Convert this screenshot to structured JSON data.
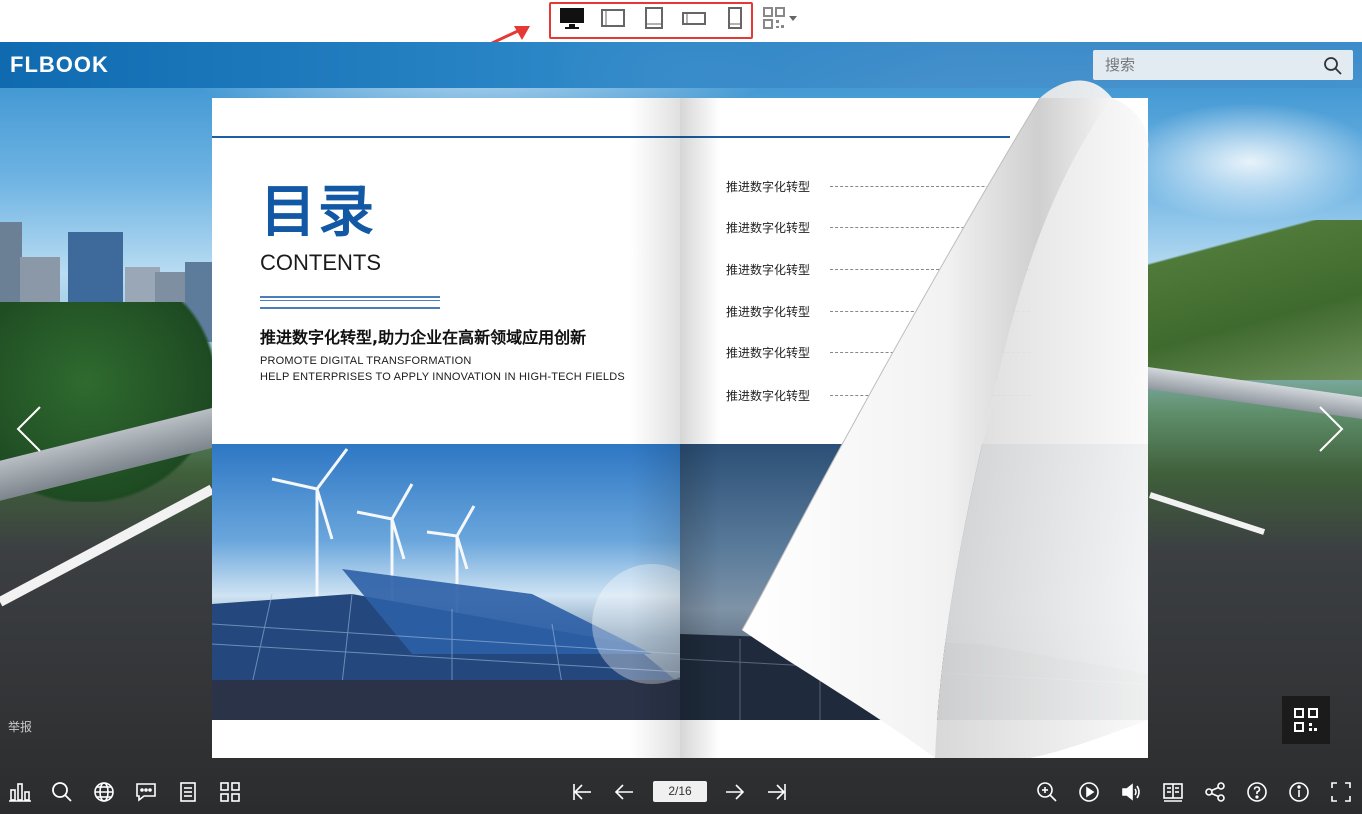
{
  "device_bar": {
    "options": [
      {
        "icon": "desktop-icon"
      },
      {
        "icon": "tablet-landscape-icon"
      },
      {
        "icon": "tablet-portrait-icon"
      },
      {
        "icon": "phone-landscape-icon"
      },
      {
        "icon": "phone-portrait-icon"
      }
    ],
    "qr_menu_icon": "qr-code-icon",
    "highlight_color": "#e53935"
  },
  "header": {
    "logo": "FLBOOK",
    "search": {
      "placeholder": "搜索",
      "value": ""
    }
  },
  "book": {
    "left_page": {
      "title": "目录",
      "subtitle": "CONTENTS",
      "headline": "推进数字化转型,助力企业在高新领域应用创新",
      "english_line1": "PROMOTE DIGITAL TRANSFORMATION",
      "english_line2": "HELP ENTERPRISES TO APPLY INNOVATION IN HIGH-TECH FIELDS"
    },
    "right_page": {
      "toc_items": [
        "推进数字化转型",
        "推进数字化转型",
        "推进数字化转型",
        "推进数字化转型",
        "推进数字化转型",
        "推进数字化转型"
      ]
    },
    "accent_color": "#1258a4"
  },
  "footer": {
    "report_link": "举报",
    "page_indicator": "2/16",
    "left_tools": [
      "stats-icon",
      "search-icon",
      "globe-icon",
      "comment-icon",
      "text-icon",
      "thumbnails-icon"
    ],
    "nav_tools": [
      "first-page-icon",
      "prev-page-icon",
      "next-page-icon",
      "last-page-icon"
    ],
    "right_tools": [
      "zoom-in-icon",
      "autoplay-icon",
      "sound-icon",
      "bookmark-icon",
      "share-icon",
      "help-icon",
      "info-icon",
      "fullscreen-icon"
    ]
  }
}
